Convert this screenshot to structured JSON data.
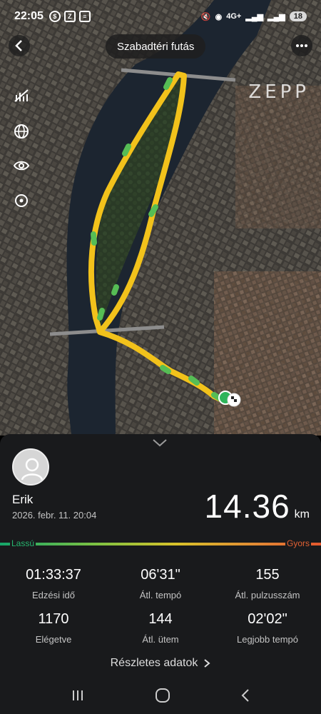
{
  "status_bar": {
    "time": "22:05",
    "network": "4G+",
    "battery": "18"
  },
  "header": {
    "title": "Szabadtéri futás",
    "logo": "ZEPP"
  },
  "map_tools": [
    "route-style-icon",
    "globe-icon",
    "eye-icon",
    "locate-icon"
  ],
  "profile": {
    "name": "Erik",
    "date": "2026. febr. 11. 20:04"
  },
  "distance": {
    "value": "14.36",
    "unit": "km"
  },
  "pace_legend": {
    "slow": "Lassú",
    "fast": "Gyors"
  },
  "stats": [
    {
      "value": "01:33:37",
      "label": "Edzési idő"
    },
    {
      "value": "06'31\"",
      "label": "Átl. tempó"
    },
    {
      "value": "155",
      "label": "Átl. pulzusszám"
    },
    {
      "value": "1170",
      "label": "Elégetve"
    },
    {
      "value": "144",
      "label": "Átl. ütem"
    },
    {
      "value": "02'02\"",
      "label": "Legjobb tempó"
    }
  ],
  "details_link": "Részletes adatok",
  "colors": {
    "route": "#f2c21b",
    "route_fast": "#56bd55",
    "panel": "#191a1c",
    "river": "#1c2530"
  }
}
